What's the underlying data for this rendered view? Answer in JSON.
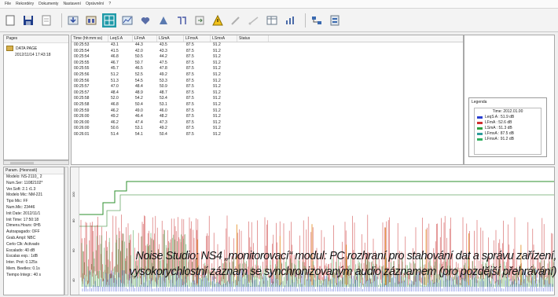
{
  "menu": {
    "items": [
      "File",
      "Rekordéry",
      "Dokumenty",
      "Nastavení",
      "Oprávnění",
      "?"
    ]
  },
  "toolbar": {
    "icons": [
      "new-icon",
      "save-icon",
      "open-icon",
      "download-icon",
      "record-icon",
      "grid-icon",
      "heart-icon",
      "split-icon",
      "level-icon",
      "export-icon",
      "warning-icon",
      "pencil-icon",
      "line-icon",
      "table-icon",
      "chart-icon",
      "network-icon",
      "report-icon"
    ]
  },
  "sidebar": {
    "header": "Pages",
    "root": "DATA PAGE",
    "child": "2012/11/14 17:43:18"
  },
  "table": {
    "columns": [
      "Time (hh:mm:ss)",
      "LeqS A",
      "LFmA",
      "LSmA",
      "LFmxA",
      "LSmxA",
      "Status"
    ],
    "rows": [
      [
        "00:25:53",
        "43.1",
        "44.3",
        "43.5",
        "87.5",
        "91.2",
        ""
      ],
      [
        "00:25:54",
        "41.5",
        "42.0",
        "43.3",
        "87.5",
        "91.2",
        ""
      ],
      [
        "00:25:54",
        "46.8",
        "50.5",
        "44.2",
        "87.5",
        "91.2",
        ""
      ],
      [
        "00:25:55",
        "46.7",
        "50.7",
        "47.5",
        "87.5",
        "91.2",
        ""
      ],
      [
        "00:25:55",
        "45.7",
        "46.5",
        "47.8",
        "87.5",
        "91.2",
        ""
      ],
      [
        "00:25:56",
        "51.2",
        "52.5",
        "49.2",
        "87.5",
        "91.2",
        ""
      ],
      [
        "00:25:56",
        "51.3",
        "54.5",
        "53.3",
        "87.5",
        "91.2",
        ""
      ],
      [
        "00:25:57",
        "47.0",
        "48.4",
        "50.9",
        "87.5",
        "91.2",
        ""
      ],
      [
        "00:25:57",
        "48.4",
        "48.9",
        "48.7",
        "87.5",
        "91.2",
        ""
      ],
      [
        "00:25:58",
        "52.0",
        "54.2",
        "53.4",
        "87.5",
        "91.2",
        ""
      ],
      [
        "00:25:58",
        "46.8",
        "50.4",
        "53.1",
        "87.5",
        "91.2",
        ""
      ],
      [
        "00:25:59",
        "46.2",
        "49.0",
        "46.0",
        "87.5",
        "91.2",
        ""
      ],
      [
        "00:26:00",
        "49.2",
        "46.4",
        "48.2",
        "87.5",
        "91.2",
        ""
      ],
      [
        "00:26:00",
        "46.2",
        "47.4",
        "47.3",
        "87.5",
        "91.2",
        ""
      ],
      [
        "00:26:00",
        "50.6",
        "53.1",
        "49.2",
        "87.5",
        "91.2",
        ""
      ],
      [
        "00:26:01",
        "51.4",
        "54.1",
        "50.4",
        "87.5",
        "91.2",
        ""
      ]
    ]
  },
  "legend": {
    "title": "Legenda",
    "time": "Time: 2012.01.00",
    "items": [
      {
        "label": "LeqS A : 51.9 dB",
        "color": "#2a3fd0"
      },
      {
        "label": "LFmA : 52.6 dB",
        "color": "#d03030"
      },
      {
        "label": "LSmA : 51.3 dB",
        "color": "#30a040"
      },
      {
        "label": "LFmxA : 87.5 dB",
        "color": "#2e9c9c"
      },
      {
        "label": "LFmxA : 91.2 dB",
        "color": "#30b060"
      }
    ]
  },
  "params": {
    "header": "Param. (Hesnosti)",
    "items": [
      "Modelo: NS-2110_ 2",
      "Num.Ser: 11082102*",
      "Ver.Soft: 2.1 r1.3",
      "Modelo Mic: NM-221",
      "Tipo Mic: FF",
      "Num.Mic: 23446",
      "Init Date: 2012/11/1",
      "Init Time: 17:50:18",
      "Dimens.Hours: 0H5",
      "Autoapagado: OFF",
      "Grab.Ampl: NBC",
      "Cerlo Clk: Activado",
      "Escalado: 40 dB",
      "Escalas exp.: 1dB",
      "Inter. Prot: 0.125s",
      "Mem. Beetles: 0.1s",
      "Tiempo Integr.: 40 s"
    ]
  },
  "graph": {
    "y_ticks": [
      "100",
      "80",
      "60",
      "40"
    ]
  },
  "caption": {
    "line1": "Noise Studio: NS4 „monitorovací“ modul: PC rozhraní pro stahování dat a správu zařízení,",
    "line2": "vysokorychlostní záznam se synchronizovaným audio záznamem (pro pozdější přehrávání)"
  },
  "colors": {
    "trace_green": "#2d8f2d",
    "trace_red": "#c41f1f",
    "trace_blue": "#2a3fd0",
    "trace_orange": "#e38b1b"
  }
}
